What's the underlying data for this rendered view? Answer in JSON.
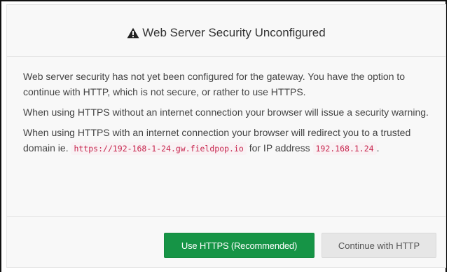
{
  "modal": {
    "title": "Web Server Security Unconfigured",
    "title_icon": "warning-triangle-icon",
    "body": {
      "p1": "Web server security has not yet been configured for the gateway. You have the option to continue with HTTP, which is not secure, or rather to use HTTPS.",
      "p2": "When using HTTPS without an internet connection your browser will issue a security warning.",
      "p3_prefix": "When using HTTPS with an internet connection your browser will redirect you to a trusted domain ie.",
      "p3_domain": "https://192-168-1-24.gw.fieldpop.io",
      "p3_middle": "for IP address",
      "p3_ip": "192.168.1.24",
      "p3_suffix": "."
    },
    "footer": {
      "primary_label": "Use HTTPS (Recommended)",
      "secondary_label": "Continue with HTTP"
    }
  },
  "colors": {
    "primary_button": "#169446",
    "secondary_button": "#e6e6e6",
    "code_text": "#c7254e",
    "modal_background": "#f8f8f8"
  }
}
